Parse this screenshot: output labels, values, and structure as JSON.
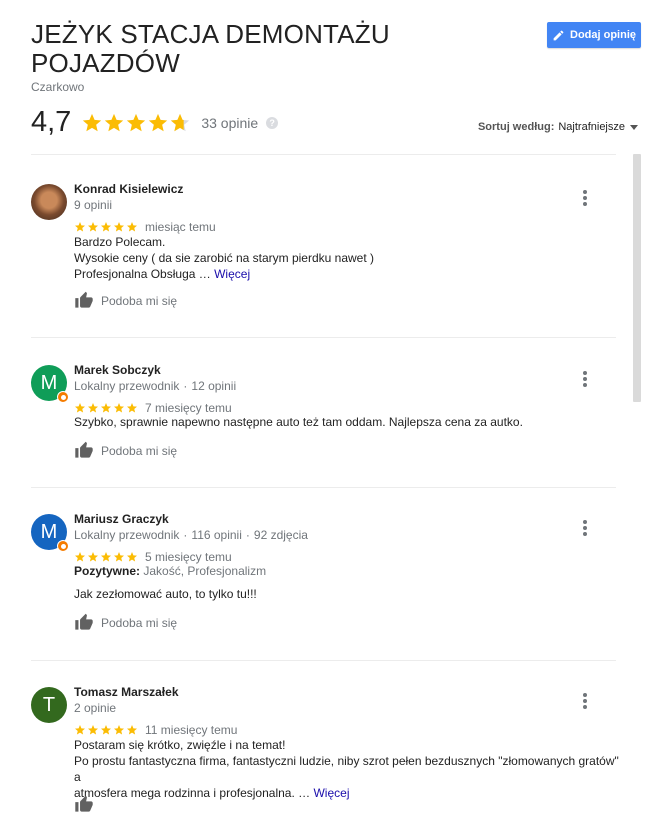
{
  "header": {
    "title": "JEŻYK STACJA DEMONTAŻU POJAZDÓW",
    "subtitle": "Czarkowo",
    "add_review_label": "Dodaj opinię",
    "rating": "4,7",
    "stars_filled": 4.7,
    "review_count": "33 opinie",
    "help_icon": "?"
  },
  "sort": {
    "label": "Sortuj według:",
    "value": "Najtrafniejsze"
  },
  "colors": {
    "accent": "#4285f4",
    "star": "#fbbc04",
    "avatar_green": "#0f9d58",
    "avatar_blue": "#1565c0",
    "avatar_darkgreen": "#33691e",
    "badge": "#f57c00"
  },
  "like_label": "Podoba mi się",
  "more_label": "Więcej",
  "reviews": [
    {
      "name": "Konrad Kisielewicz",
      "meta": "9 opinii",
      "stars": 5,
      "time": "miesiąc temu",
      "text": [
        "Bardzo Polecam.",
        "Wysokie ceny ( da sie zarobić na starym pierdku nawet )",
        "Profesjonalna Obsługa"
      ],
      "ellipsis": "…"
    },
    {
      "name": "Marek Sobczyk",
      "initial": "M",
      "meta": "Lokalny przewodnik",
      "meta2": "12 opinii",
      "stars": 5,
      "time": "7 miesięcy temu",
      "text": [
        "Szybko, sprawnie napewno następne auto też tam oddam. Najlepsza cena za autko."
      ]
    },
    {
      "name": "Mariusz Graczyk",
      "initial": "M",
      "meta": "Lokalny przewodnik",
      "meta2": "116 opinii",
      "meta3": "92 zdjęcia",
      "stars": 5,
      "time": "5 miesięcy temu",
      "positive_label": "Pozytywne:",
      "positive_value": "Jakość, Profesjonalizm",
      "text": [
        "Jak zezłomować auto, to tylko tu!!!"
      ]
    },
    {
      "name": "Tomasz Marszałek",
      "initial": "T",
      "meta": "2 opinie",
      "stars": 5,
      "time": "11 miesięcy temu",
      "text": [
        "Postaram się krótko, zwięźle i na temat!",
        "Po prostu fantastyczna firma, fantastyczni ludzie, niby szrot pełen bezdusznych \"złomowanych gratów\" a",
        "atmosfera mega rodzinna i profesjonalna."
      ],
      "ellipsis": "…"
    }
  ]
}
